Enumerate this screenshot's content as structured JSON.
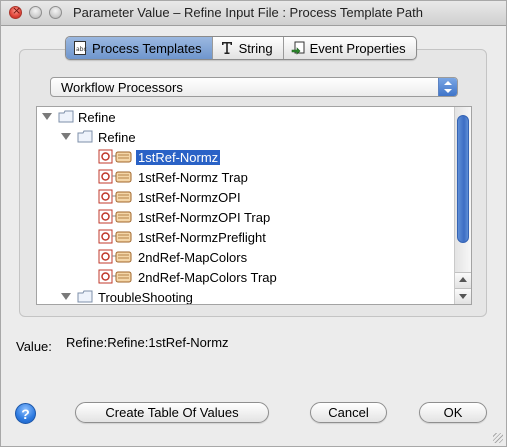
{
  "window": {
    "title": "Parameter Value – Refine Input File : Process Template Path"
  },
  "tabs": [
    {
      "label": "Process Templates",
      "icon": "document-abc-icon",
      "active": true
    },
    {
      "label": "String",
      "icon": "text-cursor-icon",
      "active": false
    },
    {
      "label": "Event Properties",
      "icon": "event-arrow-icon",
      "active": false
    }
  ],
  "dropdown": {
    "selected": "Workflow Processors"
  },
  "tree": {
    "rows": [
      {
        "label": "Refine",
        "type": "folder",
        "level": 0,
        "expanded": true
      },
      {
        "label": "Refine",
        "type": "folder",
        "level": 1,
        "expanded": true
      },
      {
        "label": "1stRef-Normz",
        "type": "process",
        "level": 2,
        "selected": true
      },
      {
        "label": "1stRef-Normz Trap",
        "type": "process",
        "level": 2
      },
      {
        "label": "1stRef-NormzOPI",
        "type": "process",
        "level": 2
      },
      {
        "label": "1stRef-NormzOPI Trap",
        "type": "process",
        "level": 2
      },
      {
        "label": "1stRef-NormzPreflight",
        "type": "process",
        "level": 2
      },
      {
        "label": "2ndRef-MapColors",
        "type": "process",
        "level": 2
      },
      {
        "label": "2ndRef-MapColors Trap",
        "type": "process",
        "level": 2
      },
      {
        "label": "TroubleShooting",
        "type": "folder",
        "level": 1,
        "expanded": true
      }
    ]
  },
  "value": {
    "label": "Value:",
    "text": "Refine:Refine:1stRef-Normz"
  },
  "buttons": {
    "help": "?",
    "create_table": "Create Table Of Values",
    "cancel": "Cancel",
    "ok": "OK"
  },
  "colors": {
    "selection": "#2a62c6",
    "tab_active": "#7da2d6",
    "scroll_thumb": "#3c6dc4"
  }
}
